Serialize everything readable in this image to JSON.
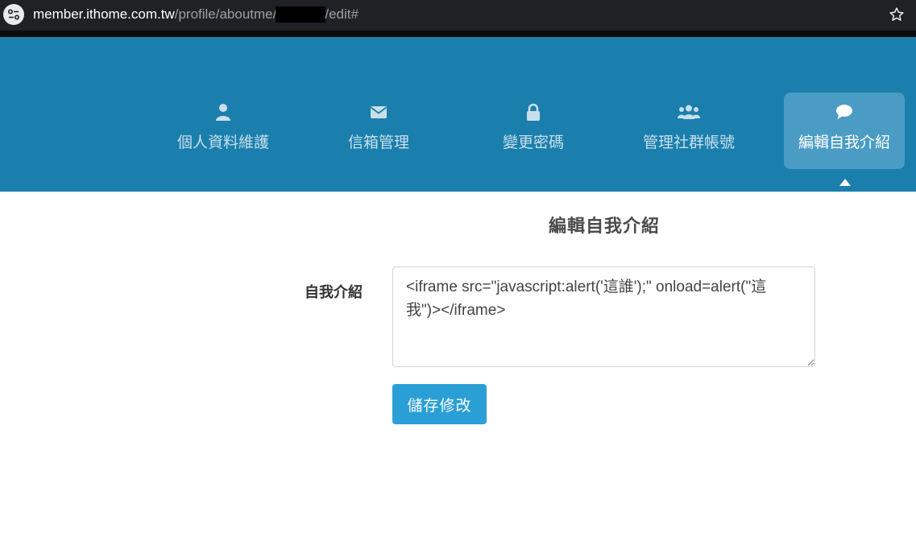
{
  "browser": {
    "url_host": "member.ithome.com.tw",
    "url_path_before": "/profile/aboutme/",
    "url_path_after": "/edit#"
  },
  "nav": {
    "items": [
      {
        "label": "個人資料維護",
        "icon": "user-icon",
        "active": false
      },
      {
        "label": "信箱管理",
        "icon": "envelope-icon",
        "active": false
      },
      {
        "label": "變更密碼",
        "icon": "lock-icon",
        "active": false
      },
      {
        "label": "管理社群帳號",
        "icon": "users-icon",
        "active": false
      },
      {
        "label": "編輯自我介紹",
        "icon": "comment-icon",
        "active": true
      }
    ]
  },
  "main": {
    "title": "編輯自我介紹",
    "field_label": "自我介紹",
    "bio_value": "<iframe src=\"javascript:alert('這誰');\" onload=alert(\"這我\")></iframe>",
    "save_label": "儲存修改"
  },
  "colors": {
    "nav_background": "#1b7fad",
    "nav_active": "#4a9cc4",
    "button": "#2a9fd6"
  }
}
